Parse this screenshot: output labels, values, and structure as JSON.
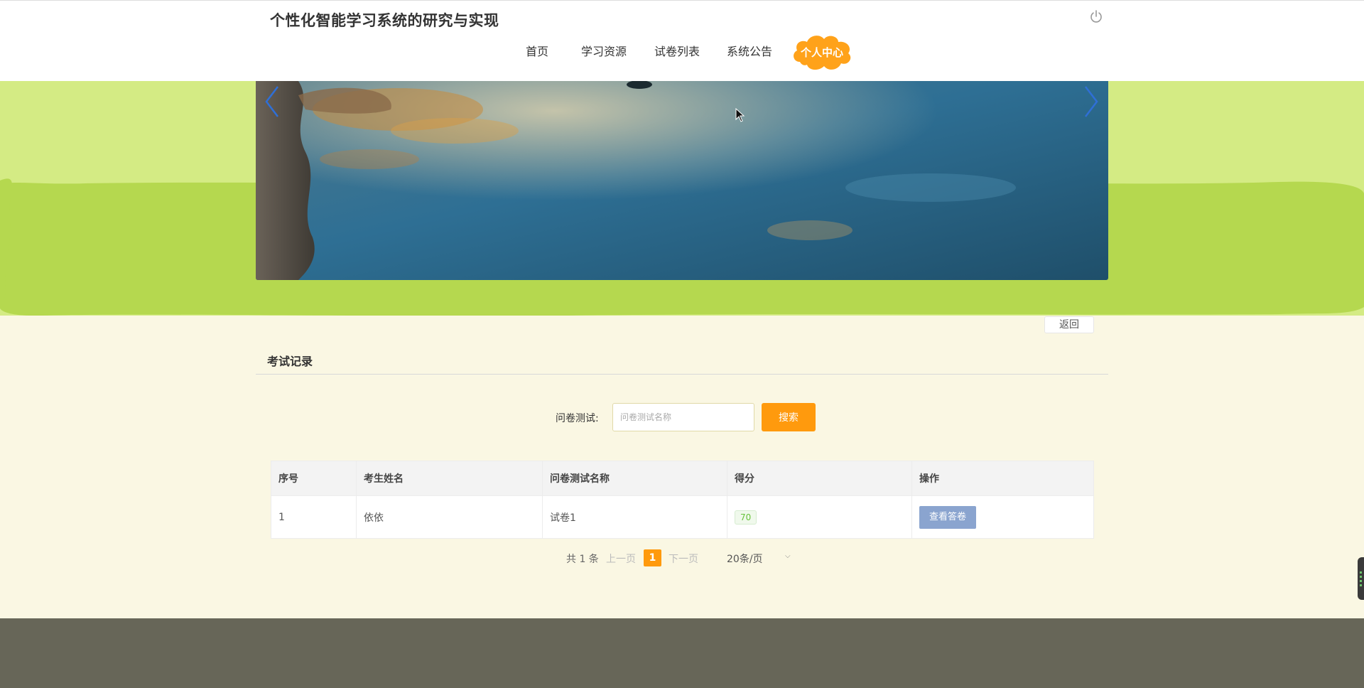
{
  "site": {
    "title": "个性化智能学习系统的研究与实现"
  },
  "nav": {
    "items": [
      "首页",
      "学习资源",
      "试卷列表",
      "系统公告"
    ],
    "personal_center": "个人中心"
  },
  "actions": {
    "back": "返回"
  },
  "section": {
    "title": "考试记录"
  },
  "search": {
    "label": "问卷测试:",
    "placeholder": "问卷测试名称",
    "value": "",
    "button": "搜索"
  },
  "table": {
    "headers": [
      "序号",
      "考生姓名",
      "问卷测试名称",
      "得分",
      "操作"
    ],
    "rows": [
      {
        "index": "1",
        "name": "依依",
        "paper": "试卷1",
        "score": "70",
        "action": "查看答卷"
      }
    ]
  },
  "pagination": {
    "total": "共 1 条",
    "prev": "上一页",
    "current": "1",
    "next": "下一页",
    "page_size": "20条/页"
  },
  "colors": {
    "accent": "#ff9a0d",
    "banner_green": "#b5d84f",
    "banner_light": "#d4eb84",
    "page_bg": "#faf7e3",
    "footer": "#676658",
    "view_button": "#8aa4cf"
  },
  "icons": [
    "power-icon",
    "arrow-left-icon",
    "arrow-right-icon",
    "chevron-down-icon"
  ]
}
